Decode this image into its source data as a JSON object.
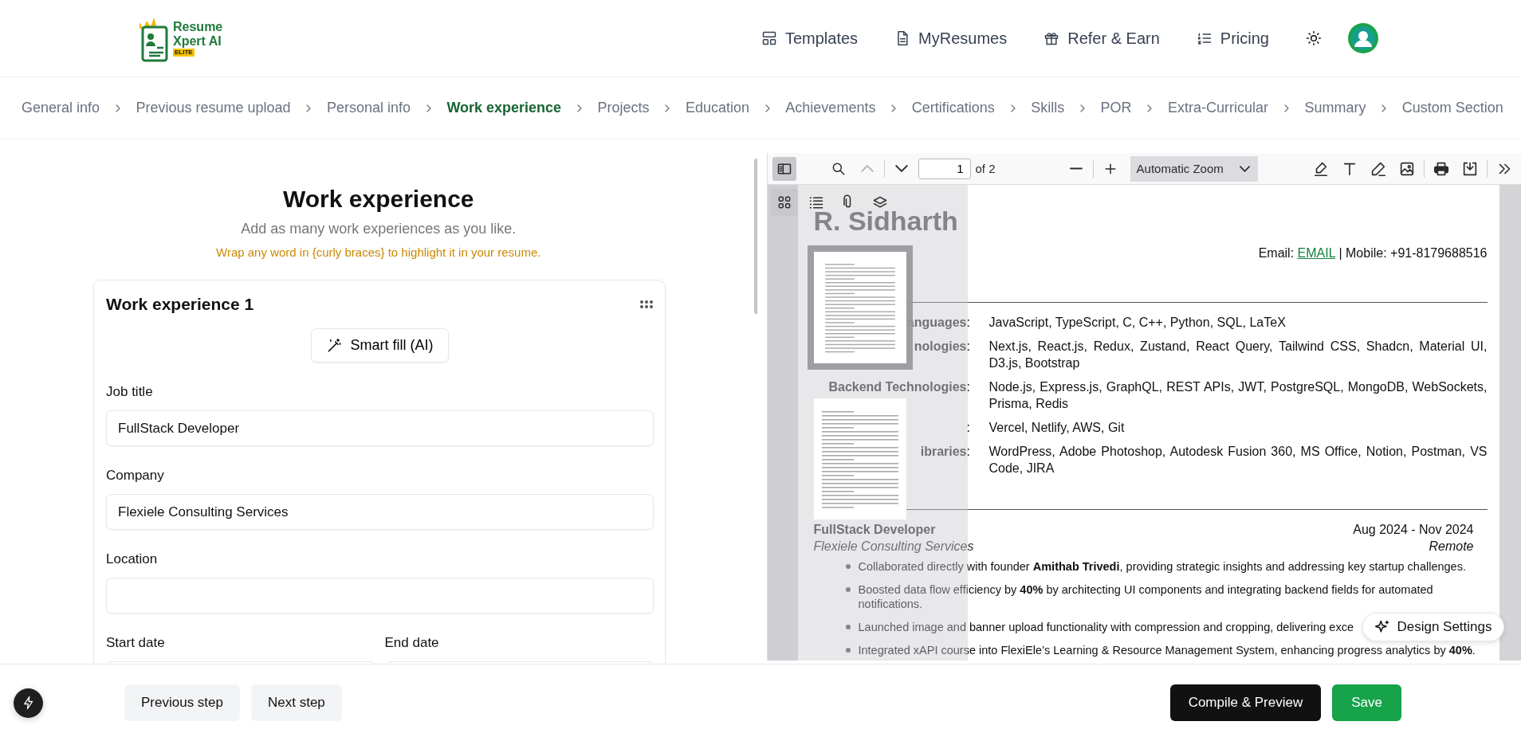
{
  "header": {
    "logo": {
      "line1": "Resume",
      "line2": "Xpert AI",
      "badge": "ELITE"
    },
    "nav": [
      {
        "kind": "templates",
        "label": "Templates"
      },
      {
        "kind": "resumes",
        "label": "MyResumes"
      },
      {
        "kind": "gift",
        "label": "Refer & Earn"
      },
      {
        "kind": "pricing",
        "label": "Pricing"
      }
    ]
  },
  "steps": [
    {
      "label": "General info",
      "selected": false
    },
    {
      "label": "Previous resume upload",
      "selected": false
    },
    {
      "label": "Personal info",
      "selected": false
    },
    {
      "label": "Work experience",
      "selected": true
    },
    {
      "label": "Projects",
      "selected": false
    },
    {
      "label": "Education",
      "selected": false
    },
    {
      "label": "Achievements",
      "selected": false
    },
    {
      "label": "Certifications",
      "selected": false
    },
    {
      "label": "Skills",
      "selected": false
    },
    {
      "label": "POR",
      "selected": false
    },
    {
      "label": "Extra-Curricular",
      "selected": false
    },
    {
      "label": "Summary",
      "selected": false
    },
    {
      "label": "Custom Section",
      "selected": false
    }
  ],
  "form": {
    "title": "Work experience",
    "subtitle": "Add as many work experiences as you like.",
    "hint": "Wrap any word in {curly braces} to highlight it in your resume.",
    "card": {
      "title": "Work experience 1",
      "smart_fill": "Smart fill (AI)",
      "fields": [
        {
          "label": "Job title",
          "value": "FullStack Developer"
        },
        {
          "label": "Company",
          "value": "Flexiele Consulting Services"
        },
        {
          "label": "Location"
        }
      ],
      "date_fields": [
        {
          "label": "Start date"
        },
        {
          "label": "End date"
        }
      ]
    }
  },
  "viewer": {
    "sidebar_open": true,
    "page_number": "1",
    "page_count": "of 2",
    "zoom": "Automatic Zoom",
    "nav_buttons": [
      {
        "kind": "previous",
        "disabled": true
      },
      {
        "kind": "next",
        "disabled": false
      }
    ],
    "tools": [
      {
        "kind": "highlight"
      },
      {
        "kind": "text"
      },
      {
        "kind": "draw"
      },
      {
        "kind": "image"
      },
      {
        "kind": "print"
      },
      {
        "kind": "download"
      },
      {
        "kind": "more"
      }
    ],
    "sidebar_views": [
      {
        "kind": "thumbnails",
        "selected": true
      },
      {
        "kind": "outline",
        "selected": false
      },
      {
        "kind": "attachments",
        "selected": false
      },
      {
        "kind": "layers",
        "selected": false
      }
    ],
    "thumbnails": [
      {
        "selected": true
      },
      {
        "selected": false
      }
    ],
    "design_settings": "Design Settings",
    "resume": {
      "name": "R. Sidharth",
      "email_label": "Email:",
      "email_link": "EMAIL",
      "mobile": "| Mobile: +91-8179688516",
      "skills": [
        {
          "label": "anguages",
          "sep": ":",
          "value": "JavaScript, TypeScript, C, C++, Python, SQL, LaTeX"
        },
        {
          "label": "nologies",
          "sep": ":",
          "value": "Next.js, React.js, Redux, Zustand, React Query, Tailwind CSS, Shadcn, Material UI, D3.js, Bootstrap"
        },
        {
          "label": "Backend Technologies",
          "sep": ":",
          "value": "Node.js, Express.js, GraphQL, REST APIs, JWT, PostgreSQL, MongoDB, WebSockets, Prisma, Redis"
        },
        {
          "sep": ":",
          "value": "Vercel, Netlify, AWS, Git"
        },
        {
          "label": "ibraries",
          "sep": ":",
          "value": "WordPress, Adobe Photoshop, Autodesk Fusion 360, MS Office, Notion, Postman, VS Code, JIRA"
        }
      ],
      "experience": {
        "title": "FullStack Developer",
        "company": "Flexiele Consulting Services",
        "dates": "Aug 2024 - Nov 2024",
        "location": "Remote",
        "bullets": [
          "Collaborated directly with founder **Amithab Trivedi**, providing strategic insights and addressing key startup challenges.",
          "Boosted data flow efficiency by **40%** by architecting UI components and integrating backend fields for automated notifications.",
          "Launched image and banner upload functionality with compression and cropping, delivering exce",
          "Integrated xAPI course into FlexiEle’s Learning & Resource Management System, enhancing progress analytics by **40%**."
        ]
      }
    }
  },
  "footer": {
    "buttons": [
      {
        "kind": "secondary",
        "label": "Previous step"
      },
      {
        "kind": "secondary",
        "label": "Next step"
      },
      {
        "kind": "dark",
        "label": "Compile & Preview"
      },
      {
        "kind": "success",
        "label": "Save"
      }
    ]
  }
}
